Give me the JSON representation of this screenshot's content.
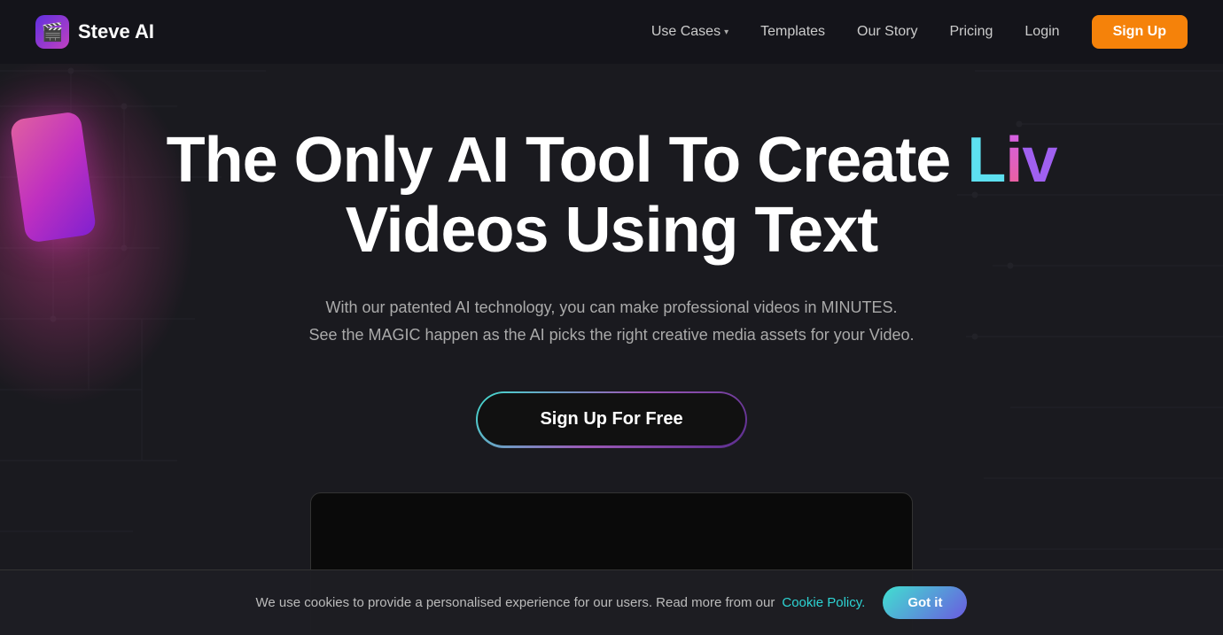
{
  "brand": {
    "logo_text": "Steve AI",
    "logo_emoji": "🎬"
  },
  "nav": {
    "use_cases_label": "Use Cases",
    "templates_label": "Templates",
    "our_story_label": "Our Story",
    "pricing_label": "Pricing",
    "login_label": "Login",
    "signup_label": "Sign Up"
  },
  "hero": {
    "title_part1": "The Only AI Tool To Create ",
    "liv_l": "L",
    "liv_i": "i",
    "liv_v": "v",
    "title_part2": " Videos Using Text",
    "subtitle_line1": "With our patented AI technology, you can make professional videos in MINUTES.",
    "subtitle_line2": "See the MAGIC happen as the AI picks the right creative media assets for your Video.",
    "cta_label": "Sign Up For Free"
  },
  "cookie": {
    "text": "We use cookies to provide a personalised experience for our users. Read more from our",
    "link_text": "Cookie Policy.",
    "button_label": "Got it"
  },
  "colors": {
    "accent_orange": "#f5820a",
    "accent_teal": "#2dd4d4",
    "accent_purple": "#9b59b6",
    "bg_dark": "#1a1a1f"
  }
}
